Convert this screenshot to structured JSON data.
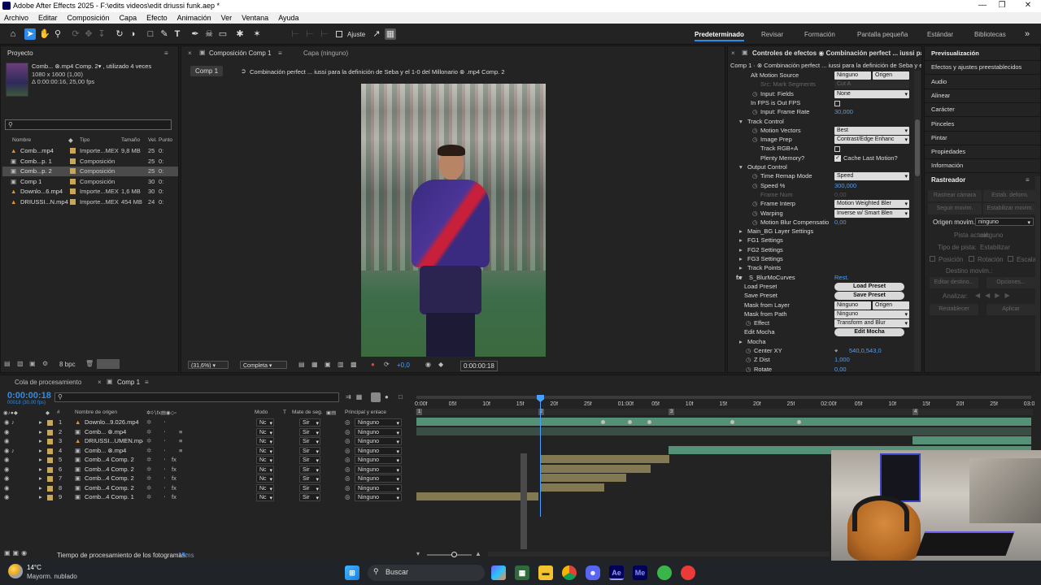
{
  "window": {
    "title": "Adobe After Effects 2025 - F:\\edits videos\\edit driussi funk.aep *"
  },
  "menu": [
    "Archivo",
    "Editar",
    "Composición",
    "Capa",
    "Efecto",
    "Animación",
    "Ver",
    "Ventana",
    "Ayuda"
  ],
  "toolbar": {
    "snap_label": "Ajuste"
  },
  "workspaces": [
    "Predeterminado",
    "Revisar",
    "Formación",
    "Pantalla pequeña",
    "Estándar",
    "Bibliotecas"
  ],
  "project": {
    "title": "Proyecto",
    "info_name": "Comb... ⊗.mp4 Comp. 2▾ , utilizado 4 veces",
    "info_dims": "1080 x 1600 (1,00)",
    "info_duration": "Δ 0:00:00:16, 25,00 fps",
    "search_placeholder": "",
    "columns": [
      "Nombre",
      "Tipo",
      "Tamaño",
      "Vel.",
      "Punto"
    ],
    "items": [
      {
        "name": "Comb...mp4",
        "type": "Importe...MEX",
        "size": "9,8 MB",
        "fps": "25",
        "extra": "0:",
        "color": "#c9a75a"
      },
      {
        "name": "Comb...p. 1",
        "type": "Composición",
        "size": "",
        "fps": "25",
        "extra": "0:",
        "color": "#c9a75a"
      },
      {
        "name": "Comb...p. 2",
        "type": "Composición",
        "size": "",
        "fps": "25",
        "extra": "0:",
        "color": "#c9a75a"
      },
      {
        "name": "Comp 1",
        "type": "Composición",
        "size": "",
        "fps": "30",
        "extra": "0:",
        "color": "#c9a75a"
      },
      {
        "name": "Downlo...6.mp4",
        "type": "Importe...MEX",
        "size": "1,6 MB",
        "fps": "30",
        "extra": "0:",
        "color": "#c9a75a"
      },
      {
        "name": "DRIUSSI...N.mp4",
        "type": "Importe...MEX",
        "size": "454 MB",
        "fps": "24",
        "extra": "0:",
        "color": "#c9a75a"
      }
    ],
    "bpc": "8 bpc"
  },
  "composition": {
    "tab": "Composición Comp 1",
    "layer_tab": "Capa (ninguno)",
    "breadcrumb_comp": "Comp 1",
    "breadcrumb_path": "Combinación perfect ... iussi para la definición de Seba y el 1-0 del Millonario ⊗ .mp4 Comp. 2",
    "zoom": "(31,6%)",
    "resolution": "Completa",
    "exposure": "+0,0",
    "timecode": "0:00:00:18"
  },
  "effects": {
    "title": "Controles de efectos",
    "title_target": "Combinación perfect ... iussi para la c",
    "sub": "Comp 1 · ⊗ Combinación perfect ... iussi para la definición de Seba y el 1",
    "rows": [
      {
        "label": "Alt Motion Source",
        "value": "Ninguno",
        "value2": "Origen",
        "kind": "drop2",
        "indent": 28
      },
      {
        "label": "Src: Mark Segments",
        "value": "Cut A",
        "kind": "dimdrop",
        "indent": 40
      },
      {
        "label": "Input: Fields",
        "value": "None",
        "kind": "drop",
        "indent": 40
      },
      {
        "label": "In FPS is Out FPS",
        "value": "",
        "kind": "check",
        "indent": 28
      },
      {
        "label": "Input: Frame Rate",
        "value": "30,000",
        "kind": "num",
        "indent": 40
      },
      {
        "label": "Track Control",
        "value": "",
        "kind": "group",
        "indent": 16
      },
      {
        "label": "Motion Vectors",
        "value": "Best",
        "kind": "drop",
        "indent": 40
      },
      {
        "label": "Image Prep",
        "value": "Contrast/Edge Enhanc",
        "kind": "drop",
        "indent": 40
      },
      {
        "label": "Track RGB+A",
        "value": "",
        "kind": "check",
        "indent": 40
      },
      {
        "label": "Plenty Memory?",
        "value": "Cache Last Motion?",
        "kind": "checked",
        "indent": 40
      },
      {
        "label": "Output Control",
        "value": "",
        "kind": "group",
        "indent": 16
      },
      {
        "label": "Time Remap Mode",
        "value": "Speed",
        "kind": "drop",
        "indent": 40
      },
      {
        "label": "Speed %",
        "value": "300,000",
        "kind": "num",
        "indent": 40
      },
      {
        "label": "Frame Num",
        "value": "0,00",
        "kind": "dimnum",
        "indent": 40
      },
      {
        "label": "Frame Interp",
        "value": "Motion Weighted Bler",
        "kind": "drop",
        "indent": 40
      },
      {
        "label": "Warping",
        "value": "Inverse w/ Smart Blen",
        "kind": "drop",
        "indent": 40
      },
      {
        "label": "Motion Blur Compensatio",
        "value": "0,00",
        "kind": "num",
        "indent": 40
      },
      {
        "label": "Main_BG Layer Settings",
        "value": "",
        "kind": "group",
        "indent": 16
      },
      {
        "label": "FG1 Settings",
        "value": "",
        "kind": "group",
        "indent": 16
      },
      {
        "label": "FG2 Settings",
        "value": "",
        "kind": "group",
        "indent": 16
      },
      {
        "label": "FG3 Settings",
        "value": "",
        "kind": "group",
        "indent": 16
      },
      {
        "label": "Track Points",
        "value": "",
        "kind": "group",
        "indent": 16
      },
      {
        "label": "S_BlurMoCurves",
        "value": "Rest.",
        "kind": "fx",
        "indent": 16
      },
      {
        "label": "Load Preset",
        "value": "Load Preset",
        "kind": "pill",
        "indent": 20
      },
      {
        "label": "Save Preset",
        "value": "Save Preset",
        "kind": "pill",
        "indent": 20
      },
      {
        "label": "Mask from Layer",
        "value": "Ninguno",
        "value2": "Origen",
        "kind": "drop2",
        "indent": 20
      },
      {
        "label": "Mask from Path",
        "value": "Ninguno",
        "kind": "drop",
        "indent": 20
      },
      {
        "label": "Effect",
        "value": "Transform and Blur",
        "kind": "drop",
        "indent": 32
      },
      {
        "label": "Edit Mocha",
        "value": "Edit Mocha",
        "kind": "pill",
        "indent": 20
      },
      {
        "label": "Mocha",
        "value": "",
        "kind": "group",
        "indent": 16
      },
      {
        "label": "Center XY",
        "value": "540,0,543,0",
        "kind": "point",
        "indent": 32
      },
      {
        "label": "Z Dist",
        "value": "1,000",
        "kind": "num",
        "indent": 32
      },
      {
        "label": "Rotate",
        "value": "0,00",
        "kind": "num",
        "indent": 32
      }
    ]
  },
  "right_panel": {
    "items": [
      "Previsualización",
      "Efectos y ajustes preestablecidos",
      "Audio",
      "Alinear",
      "Carácter",
      "Pinceles",
      "Pintar",
      "Propiedades",
      "Información"
    ],
    "tracker_title": "Rastreador",
    "buttons": [
      "Rastrear cámara",
      "Estab. deform.",
      "Seguir movim.",
      "Estabilizar movim."
    ],
    "origin_label": "Origen movim.:",
    "origin_value": "ninguno",
    "current_track_label": "Pista actual:",
    "current_track_value": "ninguno",
    "track_type_label": "Tipo de pista:",
    "track_type_value": "Estabilizar",
    "pos": "Posición",
    "rot": "Rotación",
    "scale": "Escala",
    "target": "Destino movim.:",
    "edit_target": "Editar destino...",
    "options": "Opciones...",
    "analyze": "Analizar:",
    "reset": "Restablecer",
    "apply": "Aplicar"
  },
  "timeline": {
    "render_queue": "Cola de procesamiento",
    "comp_tab": "Comp 1",
    "timecode": "0:00:00:18",
    "timecode_sub": "00018 (30,00 fps)",
    "columns": {
      "source": "Nombre de origen",
      "mode": "Modo",
      "t": "T",
      "matte": "Mate de seg.",
      "parent": "Principal y enlace"
    },
    "ruler": [
      "0:00f",
      "05f",
      "10f",
      "15f",
      "20f",
      "25f",
      "01:00f",
      "05f",
      "10f",
      "15f",
      "20f",
      "25f",
      "02:00f",
      "05f",
      "10f",
      "15f",
      "20f",
      "25f",
      "03:0"
    ],
    "layers": [
      {
        "num": "1",
        "name": "Downlo...9.026.mp4",
        "mode": "Nc",
        "matte": "Sir",
        "parent": "Ninguno",
        "color": "#c9a75a"
      },
      {
        "num": "2",
        "name": "Comb... ⊗.mp4",
        "mode": "Nc",
        "matte": "Sir",
        "parent": "Ninguno",
        "color": "#c9a75a"
      },
      {
        "num": "3",
        "name": "DRIUSSI...UMEN.mp4",
        "mode": "Nc",
        "matte": "Sir",
        "parent": "Ninguno",
        "color": "#c9a75a"
      },
      {
        "num": "4",
        "name": "Comb... ⊗.mp4",
        "mode": "Nc",
        "matte": "Sir",
        "parent": "Ninguno",
        "color": "#c9a75a"
      },
      {
        "num": "5",
        "name": "Comb...4 Comp. 2",
        "mode": "Nc",
        "matte": "Sir",
        "parent": "Ninguno",
        "color": "#c9a75a"
      },
      {
        "num": "6",
        "name": "Comb...4 Comp. 2",
        "mode": "Nc",
        "matte": "Sir",
        "parent": "Ninguno",
        "color": "#c9a75a"
      },
      {
        "num": "7",
        "name": "Comb...4 Comp. 2",
        "mode": "Nc",
        "matte": "Sir",
        "parent": "Ninguno",
        "color": "#c9a75a"
      },
      {
        "num": "8",
        "name": "Comb...4 Comp. 2",
        "mode": "Nc",
        "matte": "Sir",
        "parent": "Ninguno",
        "color": "#c9a75a"
      },
      {
        "num": "9",
        "name": "Comb...4 Comp. 1",
        "mode": "Nc",
        "matte": "Sir",
        "parent": "Ninguno",
        "color": "#c9a75a"
      }
    ],
    "markers": [
      "1",
      "2",
      "3",
      "4"
    ],
    "render_time_label": "Tiempo de procesamiento de los fotogramas:",
    "render_time_value": "15ms"
  },
  "taskbar": {
    "temp": "14°C",
    "weather": "Mayorm. nublado",
    "search": "Buscar"
  },
  "colors": {
    "accent": "#2d8ceb",
    "layer_green": "#5a9d7f",
    "layer_tan": "#8d8358",
    "panel": "#232323"
  }
}
